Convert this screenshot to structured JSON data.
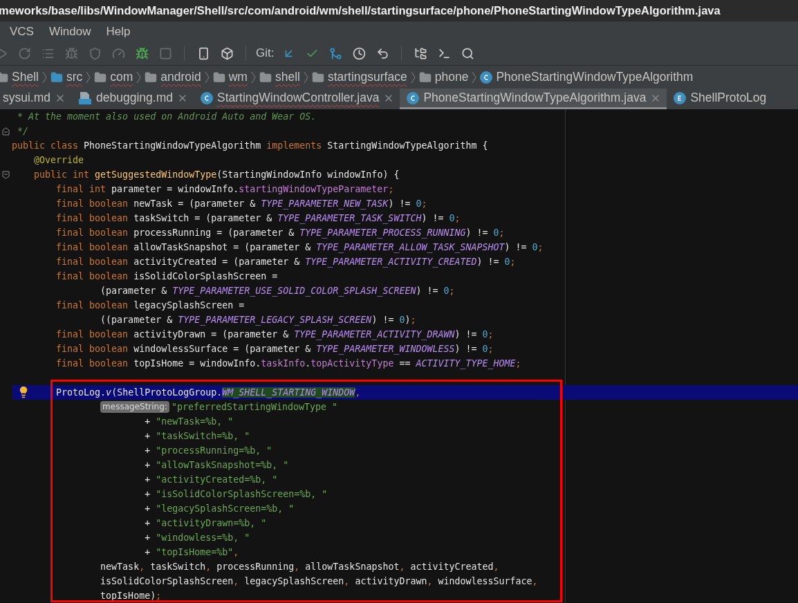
{
  "window": {
    "title": "meworks/base/libs/WindowManager/Shell/src/com/android/wm/shell/startingsurface/phone/PhoneStartingWindowTypeAlgorithm.java"
  },
  "menu": [
    "VCS",
    "Window",
    "Help"
  ],
  "toolbar": {
    "items": [
      {
        "kind": "icon",
        "disabled": true
      },
      {
        "kind": "icon",
        "disabled": true
      },
      {
        "kind": "icon",
        "disabled": true
      },
      {
        "kind": "icon",
        "disabled": true
      },
      {
        "kind": "icon",
        "disabled": true
      },
      {
        "kind": "icon",
        "disabled": true
      },
      {
        "kind": "icon",
        "disabled": false
      },
      {
        "kind": "icon",
        "disabled": true
      },
      {
        "kind": "separator"
      },
      {
        "kind": "icon",
        "disabled": false
      },
      {
        "kind": "icon",
        "disabled": false
      },
      {
        "kind": "separator"
      },
      {
        "kind": "label",
        "text": "Git:"
      },
      {
        "kind": "icon",
        "disabled": false
      },
      {
        "kind": "icon",
        "disabled": false
      },
      {
        "kind": "icon",
        "disabled": false
      },
      {
        "kind": "icon",
        "disabled": false
      },
      {
        "kind": "icon",
        "disabled": false
      },
      {
        "kind": "separator"
      },
      {
        "kind": "icon",
        "disabled": false
      },
      {
        "kind": "icon",
        "disabled": false
      },
      {
        "kind": "icon",
        "disabled": false
      }
    ]
  },
  "breadcrumbs": [
    {
      "kind": "folder",
      "label": "Shell",
      "misspelled": true
    },
    {
      "kind": "source_folder",
      "label": "src",
      "misspelled": true
    },
    {
      "kind": "folder",
      "label": "com",
      "misspelled": true
    },
    {
      "kind": "folder",
      "label": "android",
      "misspelled": true
    },
    {
      "kind": "folder",
      "label": "wm",
      "misspelled": true
    },
    {
      "kind": "folder",
      "label": "shell",
      "misspelled": true
    },
    {
      "kind": "folder",
      "label": "startingsurface",
      "misspelled": true
    },
    {
      "kind": "folder",
      "label": "phone",
      "misspelled": false
    },
    {
      "kind": "class",
      "label": "PhoneStartingWindowTypeAlgorithm",
      "misspelled": false
    }
  ],
  "tabs": [
    {
      "label": "sysui.md",
      "selected": false,
      "misspelled": false,
      "closable": true
    },
    {
      "kind": "md",
      "label": "debugging.md",
      "selected": false,
      "misspelled": false,
      "closable": true
    },
    {
      "kind": "class",
      "label": "StartingWindowController.java",
      "selected": false,
      "misspelled": true,
      "closable": true
    },
    {
      "kind": "class",
      "label": "PhoneStartingWindowTypeAlgorithm.java",
      "selected": true,
      "misspelled": false,
      "closable": true
    },
    {
      "kind": "enum",
      "label": "ShellProtoLog",
      "selected": false,
      "misspelled": false,
      "closable": false
    }
  ],
  "editor": {
    "lines": [
      {
        "current": false,
        "tokens": [
          {
            "kind": "comment",
            "text": " * At the moment also used on Android Auto and Wear OS."
          }
        ]
      },
      {
        "current": false,
        "kind": "fold_end",
        "tokens": [
          {
            "kind": "comment",
            "text": " */"
          }
        ]
      },
      {
        "current": false,
        "tokens": [
          {
            "kind": "keyword",
            "text": "public class "
          },
          {
            "kind": "plain",
            "text": "PhoneStartingWindowTypeAlgorithm "
          },
          {
            "kind": "keyword",
            "text": "implements "
          },
          {
            "kind": "plain",
            "text": "StartingWindowTypeAlgorithm {"
          }
        ]
      },
      {
        "current": false,
        "tokens": [
          {
            "kind": "annotation",
            "text": "    @Override"
          }
        ]
      },
      {
        "current": false,
        "kind": "fold_start",
        "tokens": [
          {
            "kind": "keyword",
            "text": "    public int "
          },
          {
            "kind": "method",
            "text": "getSuggestedWindowType"
          },
          {
            "kind": "plain",
            "text": "(StartingWindowInfo windowInfo) {"
          }
        ]
      },
      {
        "current": false,
        "tokens": [
          {
            "kind": "keyword",
            "text": "        final int "
          },
          {
            "kind": "plain",
            "text": "parameter = windowInfo."
          },
          {
            "kind": "field",
            "text": "startingWindowTypeParameter"
          },
          {
            "kind": "punct",
            "text": ";"
          }
        ]
      },
      {
        "current": false,
        "tokens": [
          {
            "kind": "keyword",
            "text": "        final boolean "
          },
          {
            "kind": "plain",
            "text": "newTask = (parameter & "
          },
          {
            "kind": "constant",
            "text": "TYPE_PARAMETER_NEW_TASK"
          },
          {
            "kind": "plain",
            "text": ") != "
          },
          {
            "kind": "number",
            "text": "0"
          },
          {
            "kind": "punct",
            "text": ";"
          }
        ]
      },
      {
        "current": false,
        "tokens": [
          {
            "kind": "keyword",
            "text": "        final boolean "
          },
          {
            "kind": "plain",
            "text": "taskSwitch = (parameter & "
          },
          {
            "kind": "constant",
            "text": "TYPE_PARAMETER_TASK_SWITCH"
          },
          {
            "kind": "plain",
            "text": ") != "
          },
          {
            "kind": "number",
            "text": "0"
          },
          {
            "kind": "punct",
            "text": ";"
          }
        ]
      },
      {
        "current": false,
        "tokens": [
          {
            "kind": "keyword",
            "text": "        final boolean "
          },
          {
            "kind": "plain",
            "text": "processRunning = (parameter & "
          },
          {
            "kind": "constant",
            "text": "TYPE_PARAMETER_PROCESS_RUNNING"
          },
          {
            "kind": "plain",
            "text": ") != "
          },
          {
            "kind": "number",
            "text": "0"
          },
          {
            "kind": "punct",
            "text": ";"
          }
        ]
      },
      {
        "current": false,
        "tokens": [
          {
            "kind": "keyword",
            "text": "        final boolean "
          },
          {
            "kind": "plain",
            "text": "allowTaskSnapshot = (parameter & "
          },
          {
            "kind": "constant",
            "text": "TYPE_PARAMETER_ALLOW_TASK_SNAPSHOT"
          },
          {
            "kind": "plain",
            "text": ") != "
          },
          {
            "kind": "number",
            "text": "0"
          },
          {
            "kind": "punct",
            "text": ";"
          }
        ]
      },
      {
        "current": false,
        "tokens": [
          {
            "kind": "keyword",
            "text": "        final boolean "
          },
          {
            "kind": "plain",
            "text": "activityCreated = (parameter & "
          },
          {
            "kind": "constant",
            "text": "TYPE_PARAMETER_ACTIVITY_CREATED"
          },
          {
            "kind": "plain",
            "text": ") != "
          },
          {
            "kind": "number",
            "text": "0"
          },
          {
            "kind": "punct",
            "text": ";"
          }
        ]
      },
      {
        "current": false,
        "tokens": [
          {
            "kind": "keyword",
            "text": "        final boolean "
          },
          {
            "kind": "plain",
            "text": "isSolidColorSplashScreen ="
          }
        ]
      },
      {
        "current": false,
        "tokens": [
          {
            "kind": "plain",
            "text": "                (parameter & "
          },
          {
            "kind": "constant",
            "text": "TYPE_PARAMETER_USE_SOLID_COLOR_SPLASH_SCREEN"
          },
          {
            "kind": "plain",
            "text": ") != "
          },
          {
            "kind": "number",
            "text": "0"
          },
          {
            "kind": "punct",
            "text": ";"
          }
        ]
      },
      {
        "current": false,
        "tokens": [
          {
            "kind": "keyword",
            "text": "        final boolean "
          },
          {
            "kind": "plain",
            "text": "legacySplashScreen ="
          }
        ]
      },
      {
        "current": false,
        "tokens": [
          {
            "kind": "plain",
            "text": "                ((parameter & "
          },
          {
            "kind": "constant",
            "text": "TYPE_PARAMETER_LEGACY_SPLASH_SCREEN"
          },
          {
            "kind": "plain",
            "text": ") != "
          },
          {
            "kind": "number",
            "text": "0"
          },
          {
            "kind": "plain",
            "text": ")"
          },
          {
            "kind": "punct",
            "text": ";"
          }
        ]
      },
      {
        "current": false,
        "tokens": [
          {
            "kind": "keyword",
            "text": "        final boolean "
          },
          {
            "kind": "plain",
            "text": "activityDrawn = (parameter & "
          },
          {
            "kind": "constant",
            "text": "TYPE_PARAMETER_ACTIVITY_DRAWN"
          },
          {
            "kind": "plain",
            "text": ") != "
          },
          {
            "kind": "number",
            "text": "0"
          },
          {
            "kind": "punct",
            "text": ";"
          }
        ]
      },
      {
        "current": false,
        "tokens": [
          {
            "kind": "keyword",
            "text": "        final boolean "
          },
          {
            "kind": "plain",
            "text": "windowlessSurface = (parameter & "
          },
          {
            "kind": "constant",
            "text": "TYPE_PARAMETER_WINDOWLESS"
          },
          {
            "kind": "plain",
            "text": ") != "
          },
          {
            "kind": "number",
            "text": "0"
          },
          {
            "kind": "punct",
            "text": ";"
          }
        ]
      },
      {
        "current": false,
        "tokens": [
          {
            "kind": "keyword",
            "text": "        final boolean "
          },
          {
            "kind": "plain",
            "text": "topIsHome = windowInfo."
          },
          {
            "kind": "field",
            "text": "taskInfo"
          },
          {
            "kind": "plain",
            "text": "."
          },
          {
            "kind": "field",
            "text": "topActivityType"
          },
          {
            "kind": "plain",
            "text": " == "
          },
          {
            "kind": "constant",
            "text": "ACTIVITY_TYPE_HOME"
          },
          {
            "kind": "punct",
            "text": ";"
          }
        ]
      },
      {
        "current": false
      },
      {
        "current": true,
        "tokens": [
          {
            "kind": "plain",
            "text": "        ProtoLog."
          },
          {
            "kind": "static_call",
            "text": "v"
          },
          {
            "kind": "plain",
            "text": "(ShellProtoLogGroup."
          },
          {
            "kind": "constant_match",
            "text": "WM_SHELL_STARTING_WINDOW"
          },
          {
            "kind": "punct",
            "text": ","
          }
        ]
      },
      {
        "current": false,
        "tokens": [
          {
            "kind": "hint",
            "text": "                messageString:"
          },
          {
            "kind": "string",
            "text": "\"preferredStartingWindowType \""
          }
        ]
      },
      {
        "current": false,
        "tokens": [
          {
            "kind": "plain",
            "text": "                        + "
          },
          {
            "kind": "string",
            "text": "\"newTask=%b, \""
          }
        ]
      },
      {
        "current": false,
        "tokens": [
          {
            "kind": "plain",
            "text": "                        + "
          },
          {
            "kind": "string",
            "text": "\"taskSwitch=%b, \""
          }
        ]
      },
      {
        "current": false,
        "tokens": [
          {
            "kind": "plain",
            "text": "                        + "
          },
          {
            "kind": "string",
            "text": "\"processRunning=%b, \""
          }
        ]
      },
      {
        "current": false,
        "tokens": [
          {
            "kind": "plain",
            "text": "                        + "
          },
          {
            "kind": "string",
            "text": "\"allowTaskSnapshot=%b, \""
          }
        ]
      },
      {
        "current": false,
        "tokens": [
          {
            "kind": "plain",
            "text": "                        + "
          },
          {
            "kind": "string",
            "text": "\"activityCreated=%b, \""
          }
        ]
      },
      {
        "current": false,
        "tokens": [
          {
            "kind": "plain",
            "text": "                        + "
          },
          {
            "kind": "string",
            "text": "\"isSolidColorSplashScreen=%b, \""
          }
        ]
      },
      {
        "current": false,
        "tokens": [
          {
            "kind": "plain",
            "text": "                        + "
          },
          {
            "kind": "string",
            "text": "\"legacySplashScreen=%b, \""
          }
        ]
      },
      {
        "current": false,
        "tokens": [
          {
            "kind": "plain",
            "text": "                        + "
          },
          {
            "kind": "string",
            "text": "\"activityDrawn=%b, \""
          }
        ]
      },
      {
        "current": false,
        "tokens": [
          {
            "kind": "plain",
            "text": "                        + "
          },
          {
            "kind": "string",
            "text": "\"windowless=%b, \""
          }
        ]
      },
      {
        "current": false,
        "tokens": [
          {
            "kind": "plain",
            "text": "                        + "
          },
          {
            "kind": "string",
            "text": "\"topIsHome=%b\""
          },
          {
            "kind": "punct",
            "text": ","
          }
        ]
      },
      {
        "current": false,
        "tokens": [
          {
            "kind": "plain",
            "text": "                newTask"
          },
          {
            "kind": "punct",
            "text": ", "
          },
          {
            "kind": "plain",
            "text": "taskSwitch"
          },
          {
            "kind": "punct",
            "text": ", "
          },
          {
            "kind": "plain",
            "text": "processRunning"
          },
          {
            "kind": "punct",
            "text": ", "
          },
          {
            "kind": "plain",
            "text": "allowTaskSnapshot"
          },
          {
            "kind": "punct",
            "text": ", "
          },
          {
            "kind": "plain",
            "text": "activityCreated"
          },
          {
            "kind": "punct",
            "text": ","
          }
        ]
      },
      {
        "current": false,
        "tokens": [
          {
            "kind": "plain",
            "text": "                isSolidColorSplashScreen"
          },
          {
            "kind": "punct",
            "text": ", "
          },
          {
            "kind": "plain",
            "text": "legacySplashScreen"
          },
          {
            "kind": "punct",
            "text": ", "
          },
          {
            "kind": "plain",
            "text": "activityDrawn"
          },
          {
            "kind": "punct",
            "text": ", "
          },
          {
            "kind": "plain",
            "text": "windowlessSurface"
          },
          {
            "kind": "punct",
            "text": ","
          }
        ]
      },
      {
        "current": false,
        "tokens": [
          {
            "kind": "plain",
            "text": "                topIsHome)"
          },
          {
            "kind": "punct",
            "text": ";"
          }
        ]
      }
    ]
  }
}
